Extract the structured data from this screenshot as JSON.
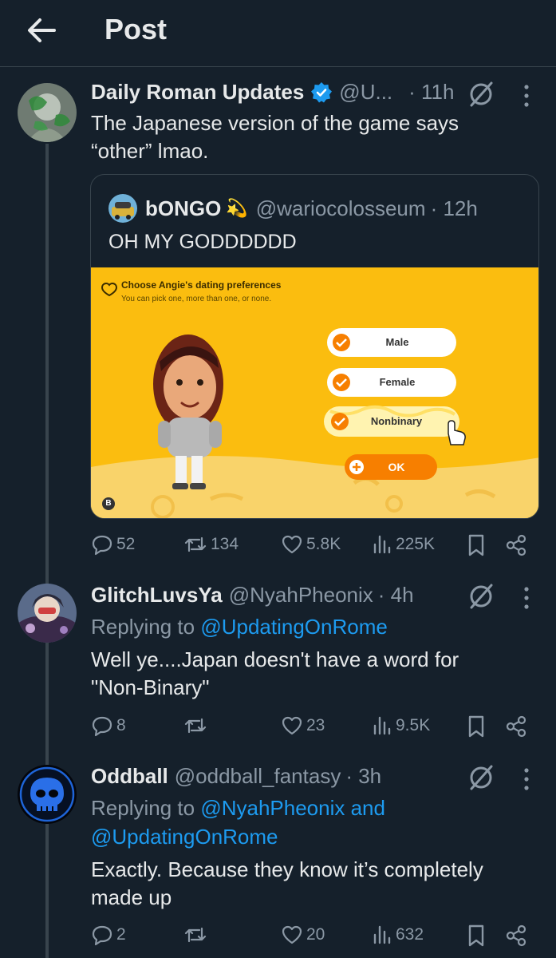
{
  "header": {
    "title": "Post",
    "back_icon": "arrow-left-icon"
  },
  "main_post": {
    "name": "Daily Roman Updates",
    "handle": "@U...",
    "time": "· 11h",
    "text_line1": "The Japanese version of the game says",
    "text_line2": "“other” lmao.",
    "verified": true
  },
  "quote": {
    "name": "bONGO",
    "emoji": "💫",
    "handle": "@wariocolosseum",
    "time": "· 12h",
    "text": "OH MY GODDDDDD",
    "image": {
      "title": "Choose Angie's dating preferences",
      "subtitle": "You can pick one, more than one, or none.",
      "options": [
        "Male",
        "Female",
        "Nonbinary"
      ],
      "ok_label": "OK",
      "back_glyph": "B"
    }
  },
  "main_actions": {
    "replies": "52",
    "reposts": "134",
    "likes": "5.8K",
    "views": "225K"
  },
  "reply1": {
    "name": "GlitchLuvsYa",
    "handle": "@NyahPheonix",
    "time": "· 4h",
    "replying_prefix": "Replying to",
    "replying_to": "@UpdatingOnRome",
    "text_line1": "Well ye....Japan doesn't have a word for",
    "text_line2": "\"Non-Binary\"",
    "actions": {
      "replies": "8",
      "reposts": "",
      "likes": "23",
      "views": "9.5K"
    }
  },
  "reply2": {
    "name": "Oddball",
    "handle": "@oddball_fantasy",
    "time": "· 3h",
    "replying_prefix": "Replying to",
    "replying_to_line1": "@NyahPheonix and",
    "replying_to_line2": "@UpdatingOnRome",
    "text_line1": "Exactly. Because they know it’s completely",
    "text_line2": "made up",
    "actions": {
      "replies": "2",
      "reposts": "",
      "likes": "20",
      "views": "632"
    }
  },
  "colors": {
    "background": "#15202b",
    "accent": "#1d9bf0",
    "muted": "#8b98a5",
    "image_bg": "#fbbd0f",
    "orange": "#f77f00"
  }
}
